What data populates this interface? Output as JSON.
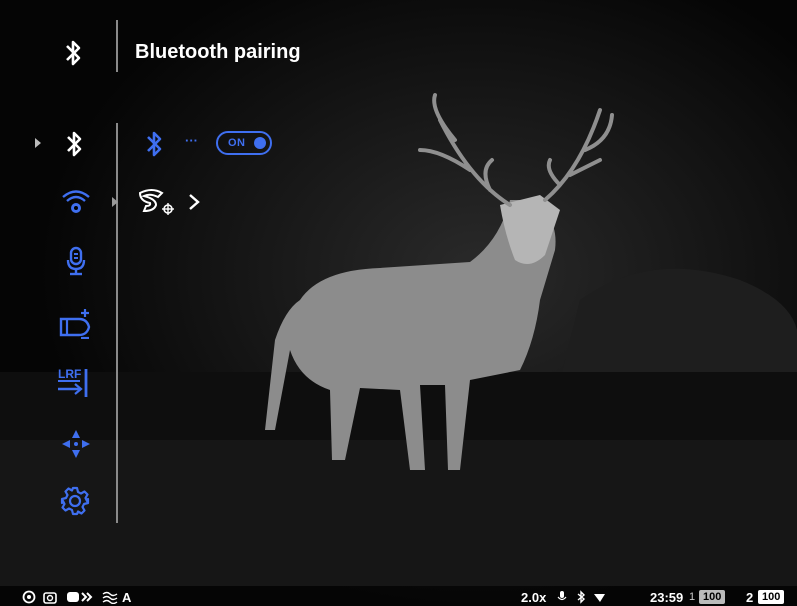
{
  "header": {
    "title": "Bluetooth pairing",
    "icon": "bluetooth-icon"
  },
  "menu": {
    "items": [
      {
        "name": "bluetooth",
        "icon": "bluetooth-icon",
        "selected": true
      },
      {
        "name": "wifi-settings",
        "icon": "wifi-gear-icon"
      },
      {
        "name": "microphone",
        "icon": "microphone-icon"
      },
      {
        "name": "ammo",
        "icon": "bullet-add-icon"
      },
      {
        "name": "rangefinder",
        "icon": "lrf-icon"
      },
      {
        "name": "zeroing",
        "icon": "crosshair-icon"
      },
      {
        "name": "settings",
        "icon": "gear-icon"
      }
    ],
    "lrf_label": "LRF"
  },
  "submenu": {
    "bluetooth_toggle": {
      "label": "ON",
      "state": true
    },
    "separator": "···",
    "pairing_app_icon": "stream-vision-icon"
  },
  "status_bar": {
    "zoom": "2.0x",
    "clock": "23:59",
    "mode": "A",
    "battery1_index": "1",
    "battery1_level": "100",
    "battery2_index": "2",
    "battery2_level": "100"
  },
  "colors": {
    "accent": "#3f6ff0",
    "text": "#ffffff",
    "background": "#000000"
  }
}
